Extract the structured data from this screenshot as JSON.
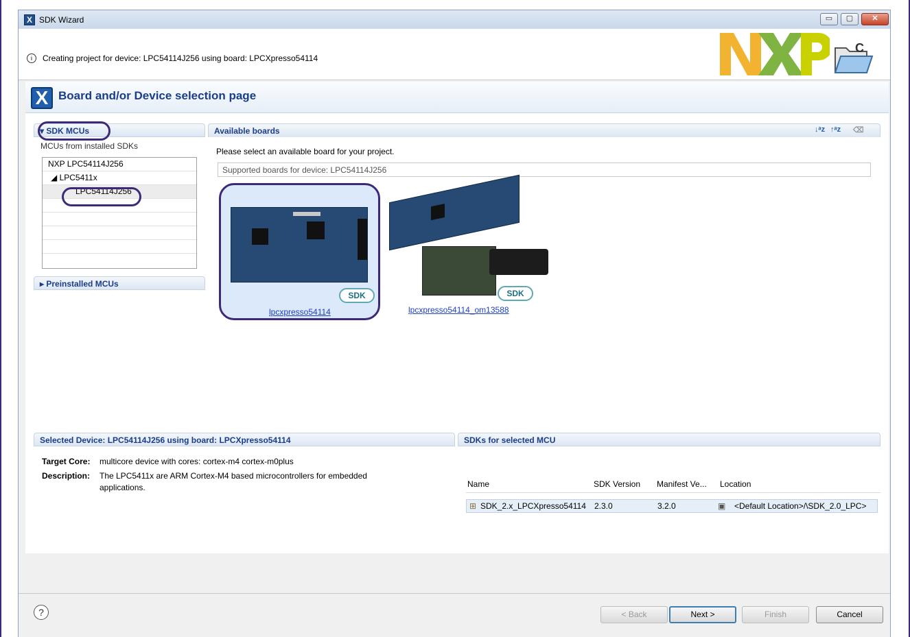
{
  "window": {
    "title": "SDK Wizard",
    "minimize": "▭",
    "maximize": "▢",
    "close": "✕"
  },
  "header": {
    "info": "Creating project for device: LPC54114J256 using board: LPCXpresso54114",
    "info_icon": "i",
    "logo": "NXP"
  },
  "page": {
    "title": "Board and/or Device selection page",
    "icon": "X"
  },
  "left": {
    "sdk_mcus": "SDK MCUs",
    "subtitle": "MCUs from installed SDKs",
    "tree": [
      "NXP LPC54114J256",
      "LPC5411x",
      "LPC54114J256"
    ],
    "preinstalled": "Preinstalled MCUs"
  },
  "boards": {
    "title": "Available boards",
    "prompt": "Please select an available board for your project.",
    "filter": "Supported boards for device: LPC54114J256",
    "items": [
      {
        "label": "lpcxpresso54114",
        "badge": "SDK"
      },
      {
        "label": "lpcxpresso54114_om13588",
        "badge": "SDK"
      }
    ]
  },
  "selected": {
    "title": "Selected Device: LPC54114J256 using board: LPCXpresso54114",
    "core_label": "Target Core:",
    "core": "multicore device with cores: cortex-m4 cortex-m0plus",
    "desc_label": "Description:",
    "desc1": "The LPC5411x are ARM Cortex-M4 based microcontrollers for embedded",
    "desc2": "applications."
  },
  "sdks": {
    "title": "SDKs for selected MCU",
    "columns": [
      "Name",
      "SDK Version",
      "Manifest Ve...",
      "Location"
    ],
    "row": [
      "SDK_2.x_LPCXpresso54114",
      "2.3.0",
      "3.2.0",
      "<Default Location>/\\SDK_2.0_LPC>"
    ]
  },
  "footer": {
    "help": "?",
    "back": "< Back",
    "next": "Next >",
    "finish": "Finish",
    "cancel": "Cancel"
  }
}
